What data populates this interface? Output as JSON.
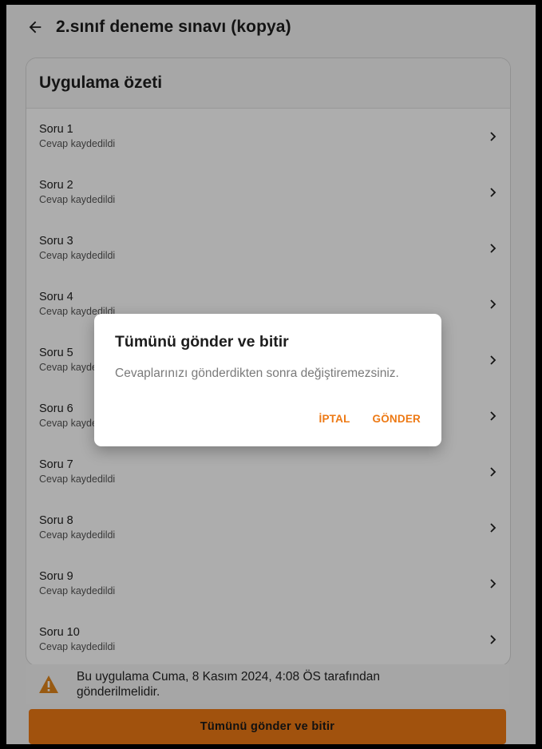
{
  "header": {
    "title": "2.sınıf deneme sınavı (kopya)",
    "back_icon": "arrow-left-icon"
  },
  "summary": {
    "heading": "Uygulama özeti",
    "questions": [
      {
        "title": "Soru 1",
        "status": "Cevap kaydedildi"
      },
      {
        "title": "Soru 2",
        "status": "Cevap kaydedildi"
      },
      {
        "title": "Soru 3",
        "status": "Cevap kaydedildi"
      },
      {
        "title": "Soru 4",
        "status": "Cevap kaydedildi"
      },
      {
        "title": "Soru 5",
        "status": "Cevap kaydedildi"
      },
      {
        "title": "Soru 6",
        "status": "Cevap kaydedildi"
      },
      {
        "title": "Soru 7",
        "status": "Cevap kaydedildi"
      },
      {
        "title": "Soru 8",
        "status": "Cevap kaydedildi"
      },
      {
        "title": "Soru 9",
        "status": "Cevap kaydedildi"
      },
      {
        "title": "Soru 10",
        "status": "Cevap kaydedildi"
      }
    ]
  },
  "notice": {
    "text": "Bu uygulama Cuma, 8 Kasım 2024, 4:08 ÖS tarafından gönderilmelidir.",
    "icon": "warning-icon"
  },
  "bottom": {
    "submit_label": "Tümünü gönder ve bitir"
  },
  "dialog": {
    "title": "Tümünü gönder ve bitir",
    "message": "Cevaplarınızı gönderdikten sonra değiştiremezsiniz.",
    "cancel_label": "İPTAL",
    "confirm_label": "GÖNDER"
  },
  "colors": {
    "accent": "#ed7914",
    "warning": "#e0851b",
    "scrim": "rgba(0,0,0,0.32)"
  }
}
